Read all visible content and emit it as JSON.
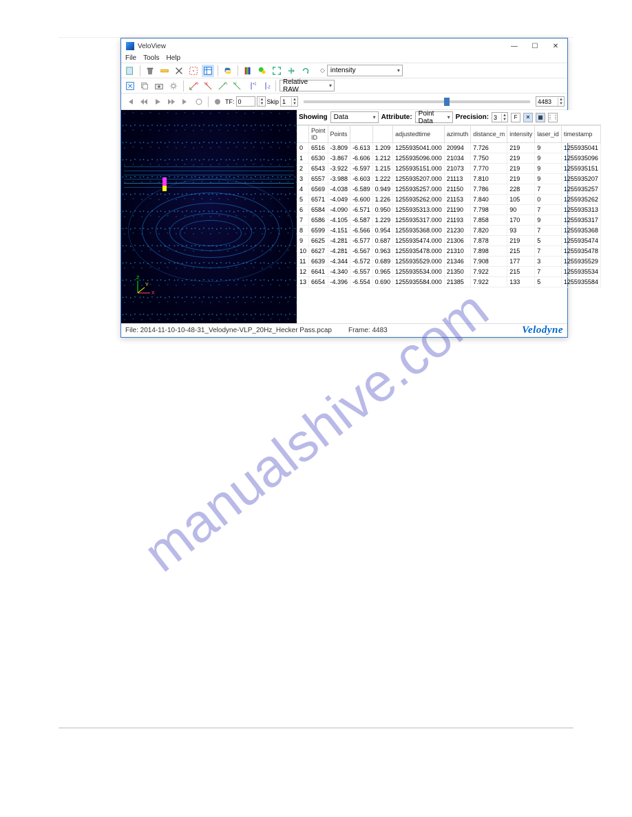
{
  "window": {
    "title": "VeloView",
    "minimize": "—",
    "maximize": "☐",
    "close": "✕"
  },
  "menu": {
    "file": "File",
    "tools": "Tools",
    "help": "Help"
  },
  "toolbar1": {
    "intensity_label": "intensity"
  },
  "toolbar2": {
    "relative_label": "Relative RAW"
  },
  "playback": {
    "tf_label": "TF:",
    "tf_value": "0",
    "skip_label": "Skip",
    "skip_value": "1",
    "frame_value": "4483"
  },
  "panel": {
    "showing": "Showing",
    "showing_value": "Data",
    "attribute": "Attribute:",
    "attribute_value": "Point Data",
    "precision": "Precision:",
    "precision_value": "3",
    "f": "F",
    "x": "✕",
    "cols": "⋮⋮"
  },
  "columns": [
    "",
    "Point ID",
    "Points",
    "",
    "",
    "adjustedtime",
    "azimuth",
    "distance_m",
    "intensity",
    "laser_id",
    "timestamp"
  ],
  "rows": [
    {
      "i": "0",
      "pid": "6516",
      "px": "-3.809",
      "py": "-6.613",
      "pz": "1.209",
      "adj": "1255935041.000",
      "az": "20994",
      "dist": "7.726",
      "int": "219",
      "lid": "9",
      "ts": "1255935041"
    },
    {
      "i": "1",
      "pid": "6530",
      "px": "-3.867",
      "py": "-6.606",
      "pz": "1.212",
      "adj": "1255935096.000",
      "az": "21034",
      "dist": "7.750",
      "int": "219",
      "lid": "9",
      "ts": "1255935096"
    },
    {
      "i": "2",
      "pid": "6543",
      "px": "-3.922",
      "py": "-6.597",
      "pz": "1.215",
      "adj": "1255935151.000",
      "az": "21073",
      "dist": "7.770",
      "int": "219",
      "lid": "9",
      "ts": "1255935151"
    },
    {
      "i": "3",
      "pid": "6557",
      "px": "-3.988",
      "py": "-6.603",
      "pz": "1.222",
      "adj": "1255935207.000",
      "az": "21113",
      "dist": "7.810",
      "int": "219",
      "lid": "9",
      "ts": "1255935207"
    },
    {
      "i": "4",
      "pid": "6569",
      "px": "-4.038",
      "py": "-6.589",
      "pz": "0.949",
      "adj": "1255935257.000",
      "az": "21150",
      "dist": "7.786",
      "int": "228",
      "lid": "7",
      "ts": "1255935257"
    },
    {
      "i": "5",
      "pid": "6571",
      "px": "-4.049",
      "py": "-6.600",
      "pz": "1.226",
      "adj": "1255935262.000",
      "az": "21153",
      "dist": "7.840",
      "int": "105",
      "lid": "0",
      "ts": "1255935262"
    },
    {
      "i": "6",
      "pid": "6584",
      "px": "-4.090",
      "py": "-6.571",
      "pz": "0.950",
      "adj": "1255935313.000",
      "az": "21190",
      "dist": "7.798",
      "int": "90",
      "lid": "7",
      "ts": "1255935313"
    },
    {
      "i": "7",
      "pid": "6586",
      "px": "-4.105",
      "py": "-6.587",
      "pz": "1.229",
      "adj": "1255935317.000",
      "az": "21193",
      "dist": "7.858",
      "int": "170",
      "lid": "9",
      "ts": "1255935317"
    },
    {
      "i": "8",
      "pid": "6599",
      "px": "-4.151",
      "py": "-6.566",
      "pz": "0.954",
      "adj": "1255935368.000",
      "az": "21230",
      "dist": "7.820",
      "int": "93",
      "lid": "7",
      "ts": "1255935368"
    },
    {
      "i": "9",
      "pid": "6625",
      "px": "-4.281",
      "py": "-6.577",
      "pz": "0.687",
      "adj": "1255935474.000",
      "az": "21306",
      "dist": "7.878",
      "int": "219",
      "lid": "5",
      "ts": "1255935474"
    },
    {
      "i": "10",
      "pid": "6627",
      "px": "-4.281",
      "py": "-6.567",
      "pz": "0.963",
      "adj": "1255935478.000",
      "az": "21310",
      "dist": "7.898",
      "int": "215",
      "lid": "7",
      "ts": "1255935478"
    },
    {
      "i": "11",
      "pid": "6639",
      "px": "-4.344",
      "py": "-6.572",
      "pz": "0.689",
      "adj": "1255935529.000",
      "az": "21346",
      "dist": "7.908",
      "int": "177",
      "lid": "3",
      "ts": "1255935529"
    },
    {
      "i": "12",
      "pid": "6641",
      "px": "-4.340",
      "py": "-6.557",
      "pz": "0.965",
      "adj": "1255935534.000",
      "az": "21350",
      "dist": "7.922",
      "int": "215",
      "lid": "7",
      "ts": "1255935534"
    },
    {
      "i": "13",
      "pid": "6654",
      "px": "-4.396",
      "py": "-6.554",
      "pz": "0.690",
      "adj": "1255935584.000",
      "az": "21385",
      "dist": "7.922",
      "int": "133",
      "lid": "5",
      "ts": "1255935584"
    }
  ],
  "status": {
    "file": "File: 2014-11-10-10-48-31_Velodyne-VLP_20Hz_Hecker Pass.pcap",
    "frame": "Frame: 4483",
    "logo": "Velodyne"
  },
  "watermark": "manualshive.com"
}
